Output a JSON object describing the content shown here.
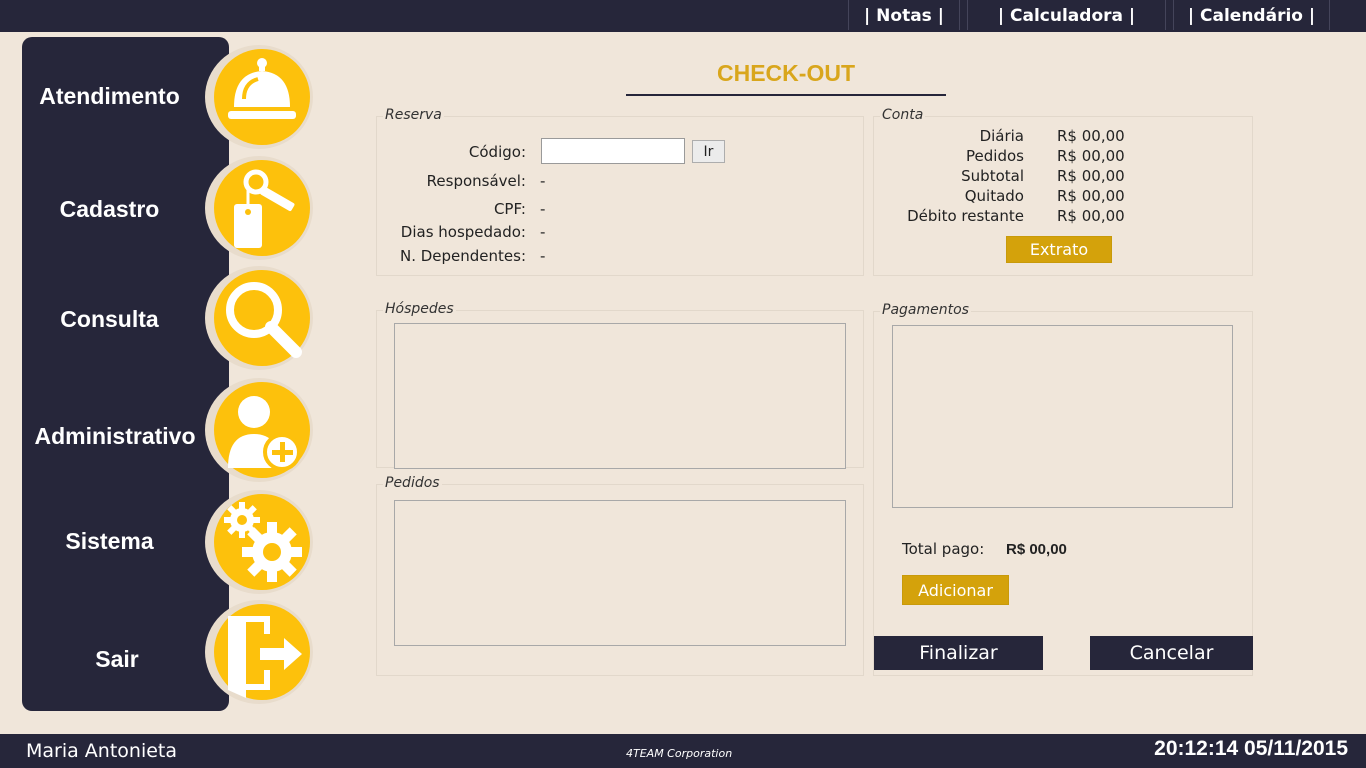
{
  "topbar": {
    "notes": "| Notas |",
    "calculator": "| Calculadora |",
    "calendar": "| Calendário |"
  },
  "sidebar": {
    "items": [
      {
        "label": "Atendimento",
        "icon": "service-bell-icon"
      },
      {
        "label": "Cadastro",
        "icon": "key-tag-icon"
      },
      {
        "label": "Consulta",
        "icon": "magnifier-icon"
      },
      {
        "label": "Administrativo",
        "icon": "add-user-icon"
      },
      {
        "label": "Sistema",
        "icon": "gears-icon"
      },
      {
        "label": "Sair",
        "icon": "exit-door-icon"
      }
    ]
  },
  "page": {
    "title": "CHECK-OUT"
  },
  "reserva": {
    "group_label": "Reserva",
    "codigo_label": "Código:",
    "codigo_value": "",
    "go_button": "Ir",
    "responsavel_label": "Responsável:",
    "responsavel_value": "-",
    "cpf_label": "CPF:",
    "cpf_value": "-",
    "dias_label": "Dias hospedado:",
    "dias_value": "-",
    "dependentes_label": "N. Dependentes:",
    "dependentes_value": "-"
  },
  "conta": {
    "group_label": "Conta",
    "rows": [
      {
        "label": "Diária",
        "value": "R$ 00,00"
      },
      {
        "label": "Pedidos",
        "value": "R$ 00,00"
      },
      {
        "label": "Subtotal",
        "value": "R$ 00,00"
      },
      {
        "label": "Quitado",
        "value": "R$ 00,00"
      },
      {
        "label": "Débito restante",
        "value": "R$ 00,00"
      }
    ],
    "extrato_button": "Extrato"
  },
  "hospedes": {
    "group_label": "Hóspedes"
  },
  "pedidos": {
    "group_label": "Pedidos"
  },
  "pagamentos": {
    "group_label": "Pagamentos",
    "total_label": "Total pago:",
    "total_value": "R$ 00,00",
    "add_button": "Adicionar"
  },
  "actions": {
    "finalizar": "Finalizar",
    "cancelar": "Cancelar"
  },
  "footer": {
    "user": "Maria Antonieta",
    "corp": "4TEAM Corporation",
    "datetime": "20:12:14 05/11/2015"
  },
  "colors": {
    "background": "#f0e6da",
    "dark": "#26263a",
    "accent": "#fdc10c",
    "gold_button": "#d4a20b",
    "title": "#d9a61c"
  }
}
